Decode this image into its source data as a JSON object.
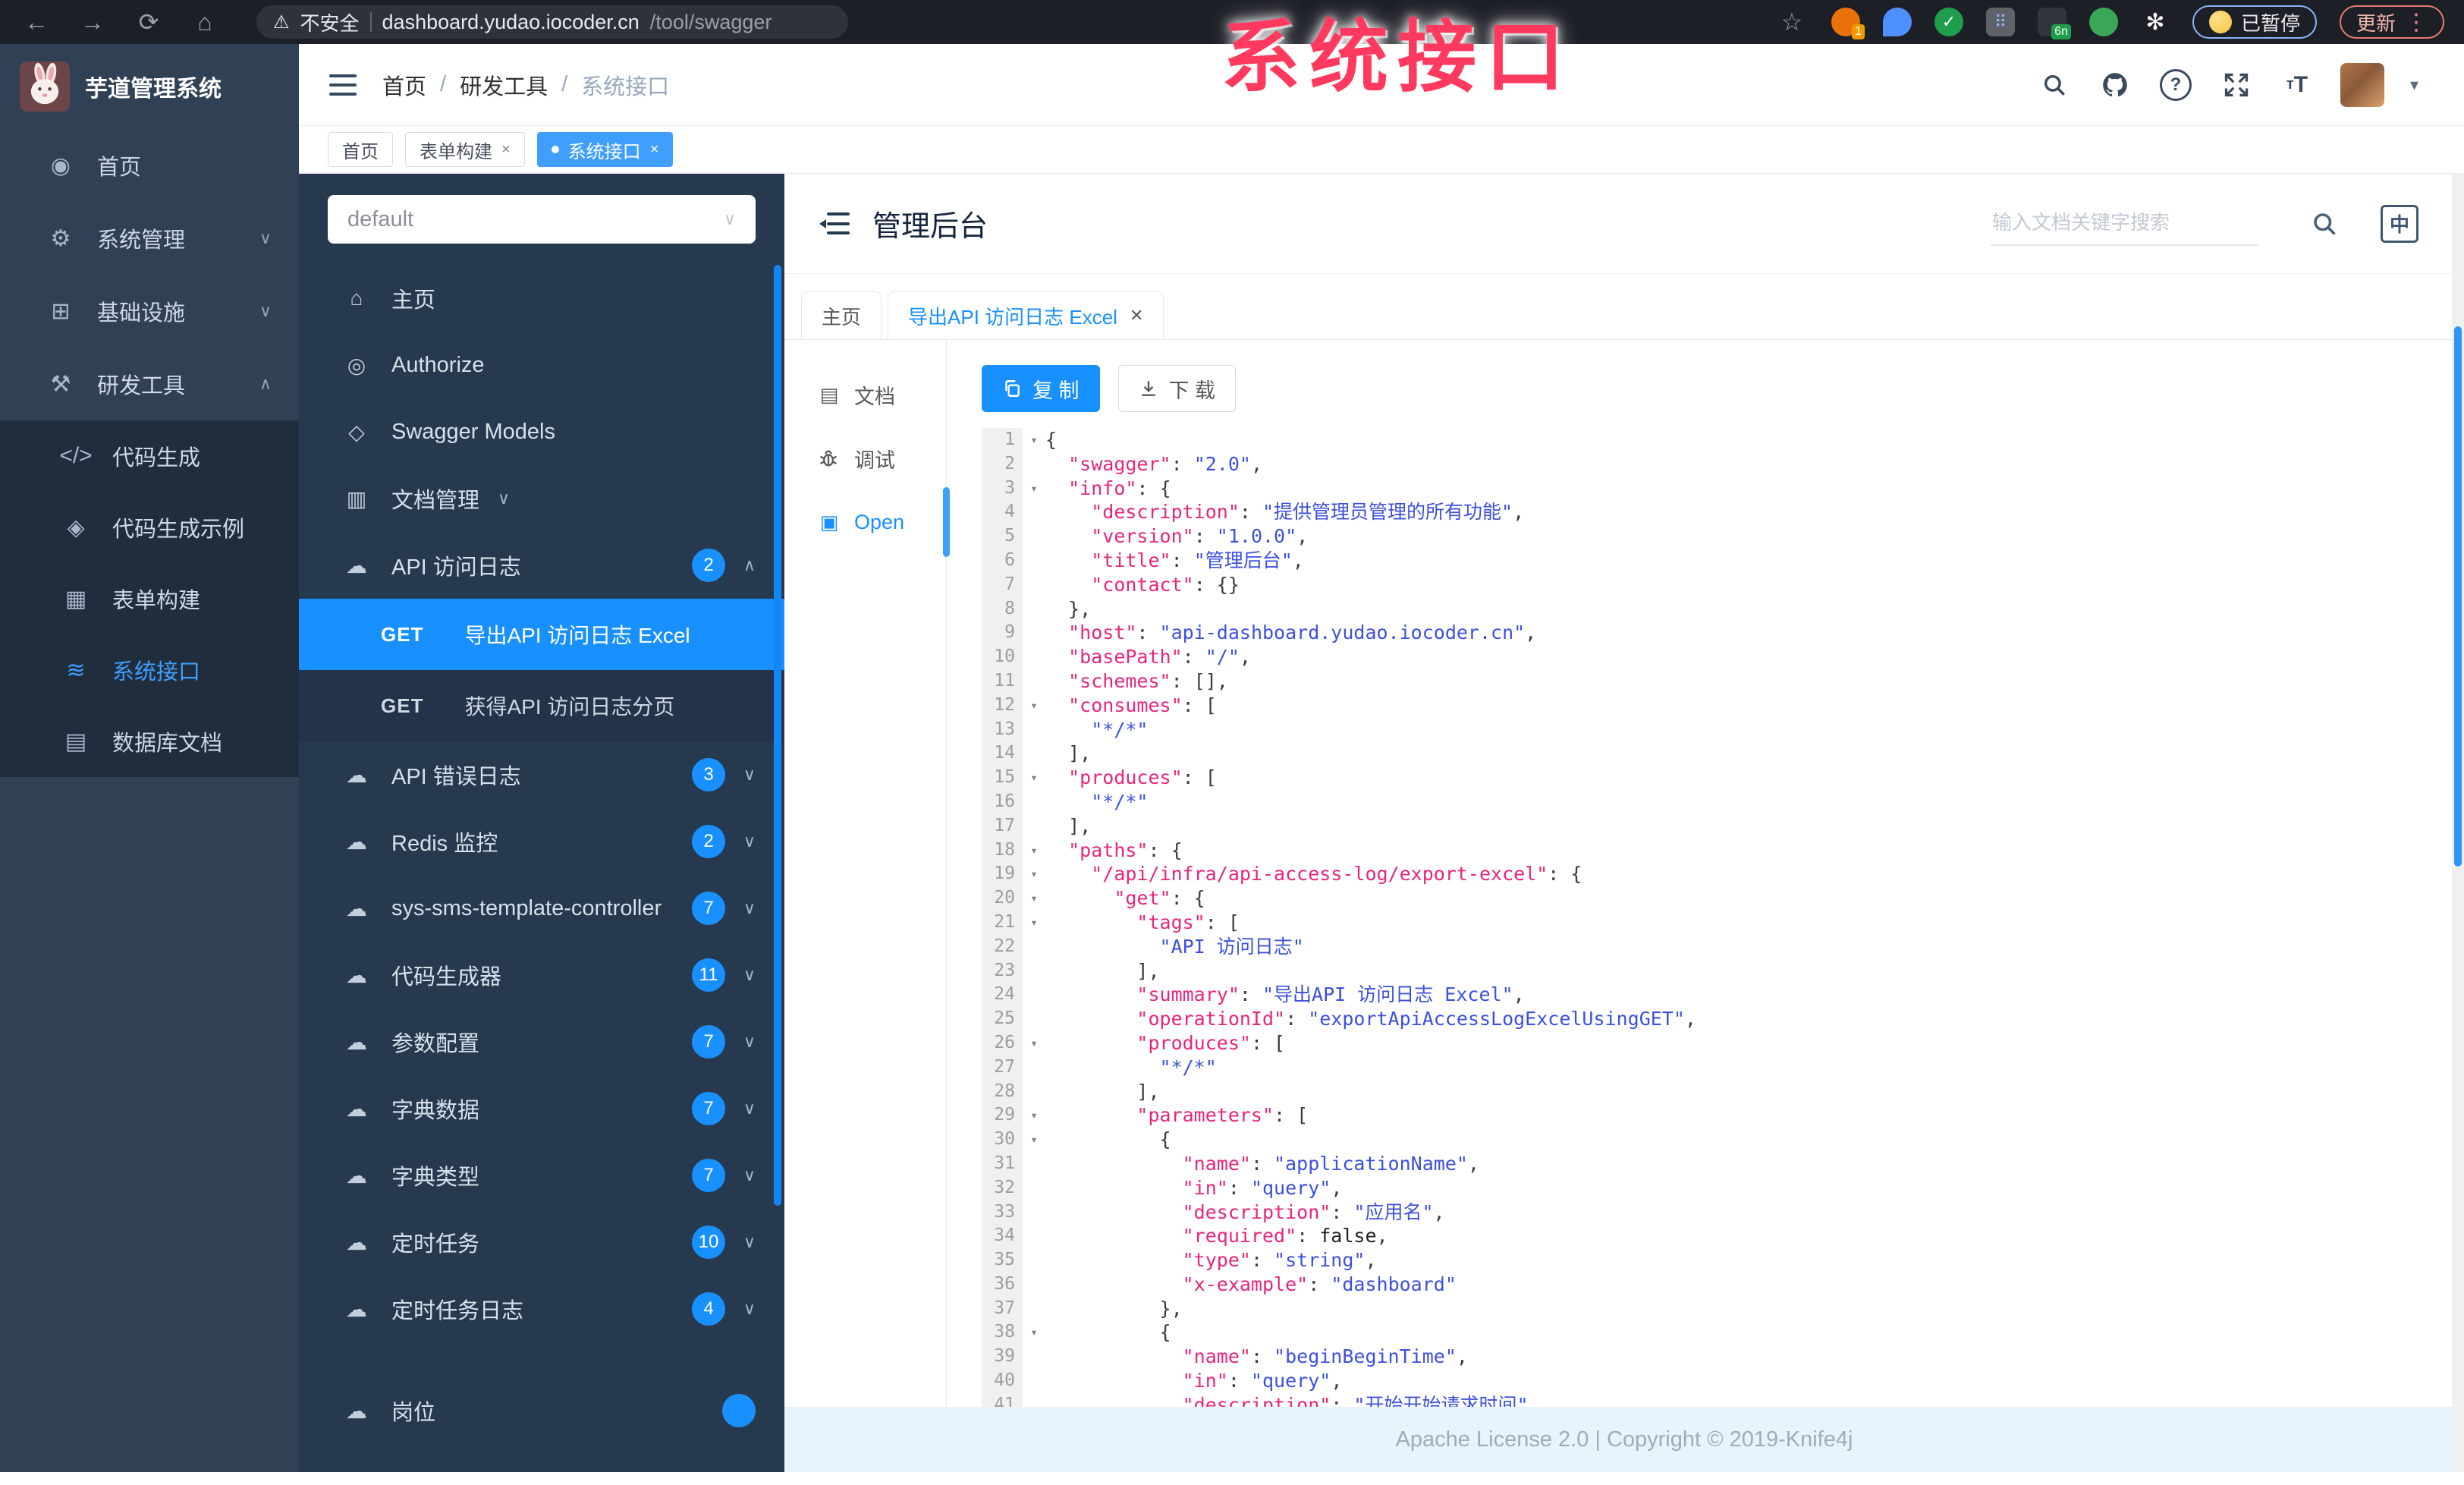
{
  "browser": {
    "security_label": "不安全",
    "host": "dashboard.yudao.iocoder.cn",
    "path": "/tool/swagger",
    "extension_badge": "1",
    "extension_badge_2": "6n",
    "paused_button": "已暂停",
    "update_button": "更新"
  },
  "watermark": "系统接口",
  "sidebar": {
    "logo_text": "芋道管理系统",
    "items": [
      {
        "label": "首页",
        "icon": "dashboard-icon",
        "glyph": "◉"
      },
      {
        "label": "系统管理",
        "icon": "gear-icon",
        "glyph": "⚙",
        "chevron": "down"
      },
      {
        "label": "基础设施",
        "icon": "infrastructure-icon",
        "glyph": "⊞",
        "chevron": "down"
      },
      {
        "label": "研发工具",
        "icon": "dev-tools-icon",
        "glyph": "⚒",
        "chevron": "up",
        "expanded": true
      }
    ],
    "dev_tools_children": [
      {
        "label": "代码生成",
        "icon": "code-icon",
        "glyph": "</>"
      },
      {
        "label": "代码生成示例",
        "icon": "shield-icon",
        "glyph": "◈"
      },
      {
        "label": "表单构建",
        "icon": "form-icon",
        "glyph": "▦"
      },
      {
        "label": "系统接口",
        "icon": "swagger-icon",
        "glyph": "≋",
        "active": true
      },
      {
        "label": "数据库文档",
        "icon": "database-icon",
        "glyph": "▤"
      }
    ]
  },
  "breadcrumb": [
    "首页",
    "研发工具",
    "系统接口"
  ],
  "tags_bar": [
    {
      "label": "首页"
    },
    {
      "label": "表单构建",
      "closable": true
    },
    {
      "label": "系统接口",
      "closable": true,
      "active": true
    }
  ],
  "api_nav": {
    "group_value": "default",
    "items": [
      {
        "label": "主页",
        "icon": "home-icon",
        "glyph": "⌂"
      },
      {
        "label": "Authorize",
        "icon": "authorize-icon",
        "glyph": "◎"
      },
      {
        "label": "Swagger Models",
        "icon": "models-icon",
        "glyph": "◇"
      },
      {
        "label": "文档管理",
        "icon": "doc-manage-icon",
        "glyph": "▥",
        "chevron": "down"
      },
      {
        "label": "API 访问日志",
        "icon": "cloud-icon",
        "glyph": "☁",
        "badge": "2",
        "chevron": "up",
        "children": [
          {
            "method": "GET",
            "label": "导出API 访问日志 Excel",
            "active": true
          },
          {
            "method": "GET",
            "label": "获得API 访问日志分页"
          }
        ]
      },
      {
        "label": "API 错误日志",
        "icon": "cloud-icon",
        "glyph": "☁",
        "badge": "3",
        "chevron": "down"
      },
      {
        "label": "Redis 监控",
        "icon": "cloud-icon",
        "glyph": "☁",
        "badge": "2",
        "chevron": "down"
      },
      {
        "label": "sys-sms-template-controller",
        "icon": "cloud-icon",
        "glyph": "☁",
        "badge": "7",
        "chevron": "down"
      },
      {
        "label": "代码生成器",
        "icon": "cloud-icon",
        "glyph": "☁",
        "badge": "11",
        "chevron": "down"
      },
      {
        "label": "参数配置",
        "icon": "cloud-icon",
        "glyph": "☁",
        "badge": "7",
        "chevron": "down"
      },
      {
        "label": "字典数据",
        "icon": "cloud-icon",
        "glyph": "☁",
        "badge": "7",
        "chevron": "down"
      },
      {
        "label": "字典类型",
        "icon": "cloud-icon",
        "glyph": "☁",
        "badge": "7",
        "chevron": "down"
      },
      {
        "label": "定时任务",
        "icon": "cloud-icon",
        "glyph": "☁",
        "badge": "10",
        "chevron": "down"
      },
      {
        "label": "定时任务日志",
        "icon": "cloud-icon",
        "glyph": "☁",
        "badge": "4",
        "chevron": "down"
      },
      {
        "label": "岗位",
        "icon": "cloud-icon",
        "glyph": "☁",
        "badge": "",
        "gap": true
      }
    ]
  },
  "panel": {
    "title": "管理后台",
    "search_placeholder": "输入文档关键字搜索",
    "lang_toggle": "中",
    "tabs": [
      {
        "label": "主页"
      },
      {
        "label": "导出API 访问日志 Excel",
        "closable": true,
        "active": true
      }
    ],
    "side_tabs": [
      {
        "label": "文档",
        "icon": "doc-icon",
        "glyph": "▤"
      },
      {
        "label": "调试",
        "icon": "debug-icon",
        "glyph": "bug"
      },
      {
        "label": "Open",
        "icon": "file-icon",
        "glyph": "▣",
        "active": true
      }
    ],
    "copy_button": "复 制",
    "download_button": "下 载"
  },
  "code": {
    "lines": [
      [
        1,
        [
          [
            "p",
            "{"
          ]
        ]
      ],
      [
        0,
        [
          [
            "p",
            "  "
          ],
          [
            "k",
            "\"swagger\""
          ],
          [
            "p",
            ": "
          ],
          [
            "s",
            "\"2.0\""
          ],
          [
            "p",
            ","
          ]
        ]
      ],
      [
        1,
        [
          [
            "p",
            "  "
          ],
          [
            "k",
            "\"info\""
          ],
          [
            "p",
            ": {"
          ]
        ]
      ],
      [
        0,
        [
          [
            "p",
            "    "
          ],
          [
            "k",
            "\"description\""
          ],
          [
            "p",
            ": "
          ],
          [
            "s",
            "\"提供管理员管理的所有功能\""
          ],
          [
            "p",
            ","
          ]
        ]
      ],
      [
        0,
        [
          [
            "p",
            "    "
          ],
          [
            "k",
            "\"version\""
          ],
          [
            "p",
            ": "
          ],
          [
            "s",
            "\"1.0.0\""
          ],
          [
            "p",
            ","
          ]
        ]
      ],
      [
        0,
        [
          [
            "p",
            "    "
          ],
          [
            "k",
            "\"title\""
          ],
          [
            "p",
            ": "
          ],
          [
            "s",
            "\"管理后台\""
          ],
          [
            "p",
            ","
          ]
        ]
      ],
      [
        0,
        [
          [
            "p",
            "    "
          ],
          [
            "k",
            "\"contact\""
          ],
          [
            "p",
            ": {}"
          ]
        ]
      ],
      [
        0,
        [
          [
            "p",
            "  },"
          ]
        ]
      ],
      [
        0,
        [
          [
            "p",
            "  "
          ],
          [
            "k",
            "\"host\""
          ],
          [
            "p",
            ": "
          ],
          [
            "s",
            "\"api-dashboard.yudao.iocoder.cn\""
          ],
          [
            "p",
            ","
          ]
        ]
      ],
      [
        0,
        [
          [
            "p",
            "  "
          ],
          [
            "k",
            "\"basePath\""
          ],
          [
            "p",
            ": "
          ],
          [
            "s",
            "\"/\""
          ],
          [
            "p",
            ","
          ]
        ]
      ],
      [
        0,
        [
          [
            "p",
            "  "
          ],
          [
            "k",
            "\"schemes\""
          ],
          [
            "p",
            ": [],"
          ]
        ]
      ],
      [
        1,
        [
          [
            "p",
            "  "
          ],
          [
            "k",
            "\"consumes\""
          ],
          [
            "p",
            ": ["
          ]
        ]
      ],
      [
        0,
        [
          [
            "p",
            "    "
          ],
          [
            "s",
            "\"*/*\""
          ]
        ]
      ],
      [
        0,
        [
          [
            "p",
            "  ],"
          ]
        ]
      ],
      [
        1,
        [
          [
            "p",
            "  "
          ],
          [
            "k",
            "\"produces\""
          ],
          [
            "p",
            ": ["
          ]
        ]
      ],
      [
        0,
        [
          [
            "p",
            "    "
          ],
          [
            "s",
            "\"*/*\""
          ]
        ]
      ],
      [
        0,
        [
          [
            "p",
            "  ],"
          ]
        ]
      ],
      [
        1,
        [
          [
            "p",
            "  "
          ],
          [
            "k",
            "\"paths\""
          ],
          [
            "p",
            ": {"
          ]
        ]
      ],
      [
        1,
        [
          [
            "p",
            "    "
          ],
          [
            "k",
            "\"/api/infra/api-access-log/export-excel\""
          ],
          [
            "p",
            ": {"
          ]
        ]
      ],
      [
        1,
        [
          [
            "p",
            "      "
          ],
          [
            "k",
            "\"get\""
          ],
          [
            "p",
            ": {"
          ]
        ]
      ],
      [
        1,
        [
          [
            "p",
            "        "
          ],
          [
            "k",
            "\"tags\""
          ],
          [
            "p",
            ": ["
          ]
        ]
      ],
      [
        0,
        [
          [
            "p",
            "          "
          ],
          [
            "s",
            "\"API 访问日志\""
          ]
        ]
      ],
      [
        0,
        [
          [
            "p",
            "        ],"
          ]
        ]
      ],
      [
        0,
        [
          [
            "p",
            "        "
          ],
          [
            "k",
            "\"summary\""
          ],
          [
            "p",
            ": "
          ],
          [
            "s",
            "\"导出API 访问日志 Excel\""
          ],
          [
            "p",
            ","
          ]
        ]
      ],
      [
        0,
        [
          [
            "p",
            "        "
          ],
          [
            "k",
            "\"operationId\""
          ],
          [
            "p",
            ": "
          ],
          [
            "s",
            "\"exportApiAccessLogExcelUsingGET\""
          ],
          [
            "p",
            ","
          ]
        ]
      ],
      [
        1,
        [
          [
            "p",
            "        "
          ],
          [
            "k",
            "\"produces\""
          ],
          [
            "p",
            ": ["
          ]
        ]
      ],
      [
        0,
        [
          [
            "p",
            "          "
          ],
          [
            "s",
            "\"*/*\""
          ]
        ]
      ],
      [
        0,
        [
          [
            "p",
            "        ],"
          ]
        ]
      ],
      [
        1,
        [
          [
            "p",
            "        "
          ],
          [
            "k",
            "\"parameters\""
          ],
          [
            "p",
            ": ["
          ]
        ]
      ],
      [
        1,
        [
          [
            "p",
            "          {"
          ]
        ]
      ],
      [
        0,
        [
          [
            "p",
            "            "
          ],
          [
            "k",
            "\"name\""
          ],
          [
            "p",
            ": "
          ],
          [
            "s",
            "\"applicationName\""
          ],
          [
            "p",
            ","
          ]
        ]
      ],
      [
        0,
        [
          [
            "p",
            "            "
          ],
          [
            "k",
            "\"in\""
          ],
          [
            "p",
            ": "
          ],
          [
            "s",
            "\"query\""
          ],
          [
            "p",
            ","
          ]
        ]
      ],
      [
        0,
        [
          [
            "p",
            "            "
          ],
          [
            "k",
            "\"description\""
          ],
          [
            "p",
            ": "
          ],
          [
            "s",
            "\"应用名\""
          ],
          [
            "p",
            ","
          ]
        ]
      ],
      [
        0,
        [
          [
            "p",
            "            "
          ],
          [
            "k",
            "\"required\""
          ],
          [
            "p",
            ": "
          ],
          [
            "b",
            "false"
          ],
          [
            "p",
            ","
          ]
        ]
      ],
      [
        0,
        [
          [
            "p",
            "            "
          ],
          [
            "k",
            "\"type\""
          ],
          [
            "p",
            ": "
          ],
          [
            "s",
            "\"string\""
          ],
          [
            "p",
            ","
          ]
        ]
      ],
      [
        0,
        [
          [
            "p",
            "            "
          ],
          [
            "k",
            "\"x-example\""
          ],
          [
            "p",
            ": "
          ],
          [
            "s",
            "\"dashboard\""
          ]
        ]
      ],
      [
        0,
        [
          [
            "p",
            "          },"
          ]
        ]
      ],
      [
        1,
        [
          [
            "p",
            "          {"
          ]
        ]
      ],
      [
        0,
        [
          [
            "p",
            "            "
          ],
          [
            "k",
            "\"name\""
          ],
          [
            "p",
            ": "
          ],
          [
            "s",
            "\"beginBeginTime\""
          ],
          [
            "p",
            ","
          ]
        ]
      ],
      [
        0,
        [
          [
            "p",
            "            "
          ],
          [
            "k",
            "\"in\""
          ],
          [
            "p",
            ": "
          ],
          [
            "s",
            "\"query\""
          ],
          [
            "p",
            ","
          ]
        ]
      ],
      [
        0,
        [
          [
            "p",
            "            "
          ],
          [
            "k",
            "\"description\""
          ],
          [
            "p",
            ": "
          ],
          [
            "s",
            "\"开始开始请求时间\""
          ]
        ]
      ]
    ]
  },
  "footer": "Apache License 2.0 | Copyright © 2019-Knife4j",
  "colors": {
    "accent": "#1890ff",
    "sidebar_active": "#409eff",
    "watermark_pink": "#ff3a5e",
    "code_key": "#e8257d",
    "code_string": "#3c50e0",
    "footer_bg": "#e8f4fb"
  }
}
